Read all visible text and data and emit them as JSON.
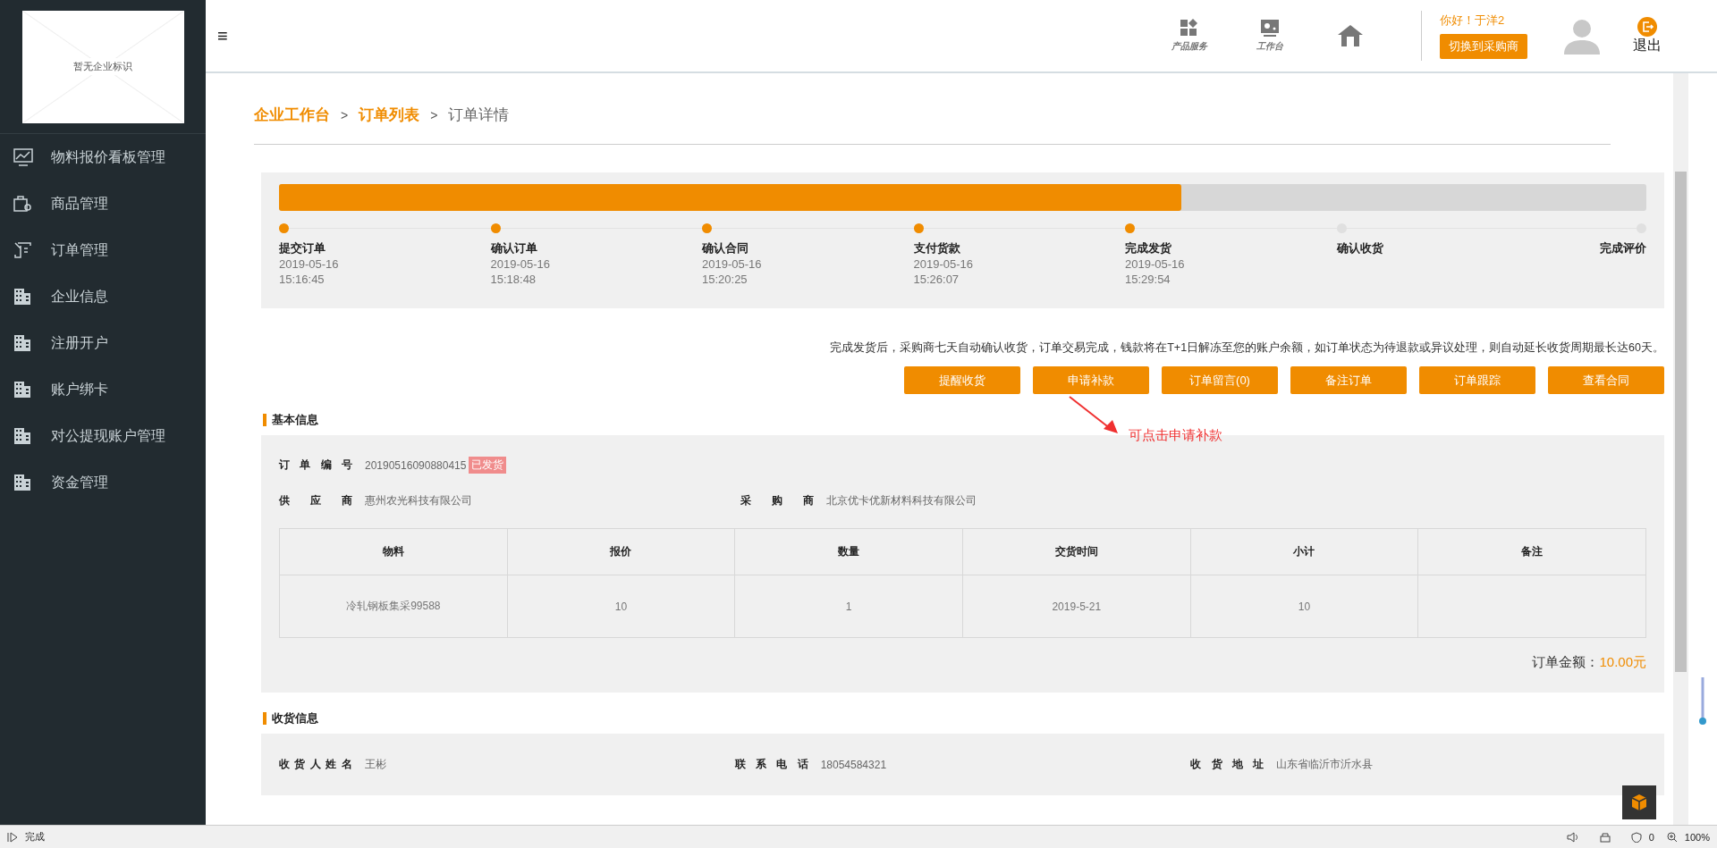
{
  "sidebar": {
    "logo_placeholder": "暂无企业标识",
    "items": [
      {
        "label": "物料报价看板管理",
        "selected": false
      },
      {
        "label": "商品管理",
        "selected": false
      },
      {
        "label": "订单管理",
        "selected": false
      },
      {
        "label": "企业信息",
        "selected": false
      },
      {
        "label": "注册开户",
        "selected": false
      },
      {
        "label": "账户绑卡",
        "selected": false
      },
      {
        "label": "对公提现账户管理",
        "selected": false
      },
      {
        "label": "资金管理",
        "selected": false
      }
    ]
  },
  "header": {
    "menu_glyph": "≡",
    "shortcuts": [
      {
        "label": "产品服务"
      },
      {
        "label": "工作台"
      }
    ],
    "greeting": "你好！于洋2",
    "switch_button": "切换到采购商",
    "logout": "退出"
  },
  "breadcrumb": [
    {
      "label": "企业工作台",
      "link": true
    },
    {
      "label": "订单列表",
      "link": true
    },
    {
      "label": "订单详情",
      "link": false
    }
  ],
  "breadcrumb_separator": ">",
  "progress": {
    "level": 0.66,
    "steps": [
      {
        "label": "提交订单",
        "date": "2019-05-16",
        "time": "15:16:45",
        "done": true
      },
      {
        "label": "确认订单",
        "date": "2019-05-16",
        "time": "15:18:48",
        "done": true
      },
      {
        "label": "确认合同",
        "date": "2019-05-16",
        "time": "15:20:25",
        "done": true
      },
      {
        "label": "支付货款",
        "date": "2019-05-16",
        "time": "15:26:07",
        "done": true
      },
      {
        "label": "完成发货",
        "date": "2019-05-16",
        "time": "15:29:54",
        "done": true
      },
      {
        "label": "确认收货",
        "done": false
      },
      {
        "label": "完成评价",
        "done": false
      }
    ]
  },
  "notice": "完成发货后，采购商七天自动确认收货，订单交易完成，钱款将在T+1日解冻至您的账户余额，如订单状态为待退款或异议处理，则自动延长收货周期最长达60天。",
  "actions": [
    "提醒收货",
    "申请补款",
    "订单留言(0)",
    "备注订单",
    "订单跟踪",
    "查看合同"
  ],
  "annotation": "可点击申请补款",
  "basic_info": {
    "title": "基本信息",
    "order_no_label": "订 单 编 号",
    "order_no": "20190516090880415",
    "status_badge": "已发货",
    "supplier_label": "供 应 商",
    "supplier": "惠州农光科技有限公司",
    "buyer_label": "采 购 商",
    "buyer": "北京优卡优新材料科技有限公司",
    "table": {
      "columns": [
        "物料",
        "报价",
        "数量",
        "交货时间",
        "小计",
        "备注"
      ],
      "rows": [
        [
          "冷轧钢板集采99588",
          "10",
          "1",
          "2019-5-21",
          "10",
          ""
        ]
      ]
    },
    "total_label": "订单金额：",
    "total": "10.00元"
  },
  "receiver_info": {
    "title": "收货信息",
    "fields": [
      {
        "label": "收 货 人 姓 名",
        "value": "王彬"
      },
      {
        "label": "联 系 电 话",
        "value": "18054584321"
      },
      {
        "label": "收 货 地 址",
        "value": "山东省临沂市沂水县"
      }
    ]
  },
  "status_bar": {
    "status": "完成",
    "blocked_count": "0",
    "zoom": "100%"
  }
}
